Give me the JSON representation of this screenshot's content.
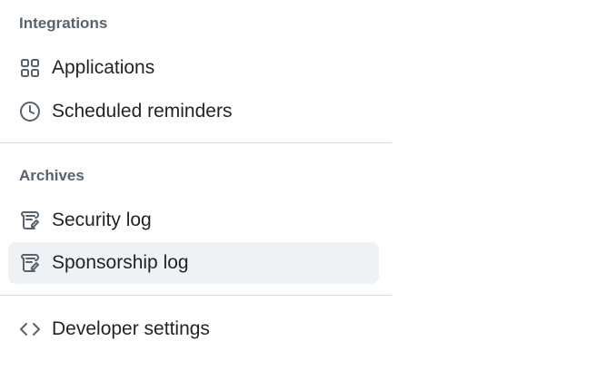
{
  "sections": {
    "integrations": {
      "heading": "Integrations",
      "items": [
        {
          "label": "Applications",
          "icon": "apps-icon"
        },
        {
          "label": "Scheduled reminders",
          "icon": "clock-icon"
        }
      ]
    },
    "archives": {
      "heading": "Archives",
      "items": [
        {
          "label": "Security log",
          "icon": "log-icon"
        },
        {
          "label": "Sponsorship log",
          "icon": "log-icon",
          "active": true
        }
      ]
    },
    "developer": {
      "items": [
        {
          "label": "Developer settings",
          "icon": "code-icon"
        }
      ]
    }
  },
  "colors": {
    "heading": "#59636e",
    "text": "#1f2328",
    "icon": "#59636e",
    "active_bg": "#eff2f5",
    "divider": "#d8dee4"
  }
}
